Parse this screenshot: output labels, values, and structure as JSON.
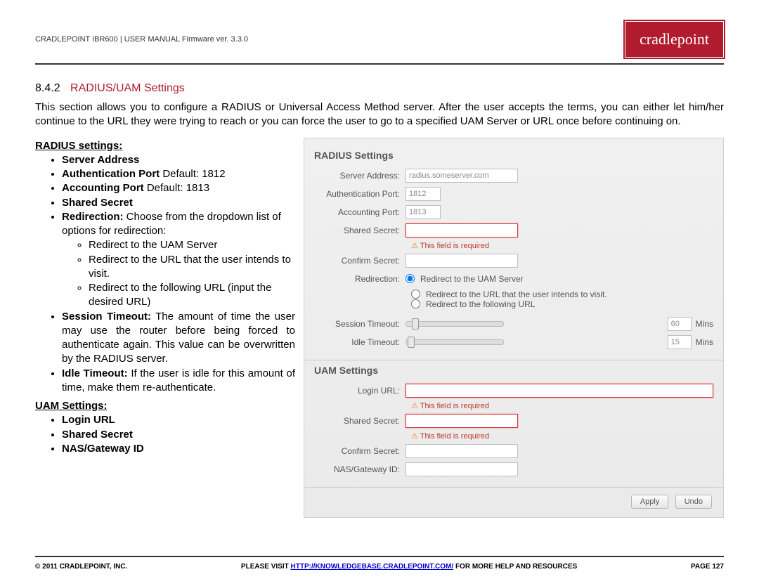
{
  "header": {
    "doc_title": "CRADLEPOINT IBR600 | USER MANUAL Firmware ver. 3.3.0",
    "brand": "cradlepoint"
  },
  "section": {
    "number": "8.4.2",
    "title": "RADIUS/UAM Settings",
    "intro": "This section allows you to configure a RADIUS or Universal Access Method server. After the user accepts the terms, you can either let him/her continue to the URL they were trying to reach or you can force the user to go to a specified UAM Server or URL once before continuing on."
  },
  "left": {
    "radius_heading": "RADIUS settings",
    "bullets": {
      "server": "Server Address",
      "auth_port_label": "Authentication Port",
      "auth_port_default": " Default: 1812",
      "acct_port_label": "Accounting Port",
      "acct_port_default": " Default: 1813",
      "shared_secret": "Shared Secret",
      "redirection_label": "Redirection:",
      "redirection_desc": " Choose from the dropdown list of options for redirection:",
      "redir_opt1": "Redirect to the UAM Server",
      "redir_opt2": "Redirect to the URL that the user intends to visit.",
      "redir_opt3": "Redirect to the following URL (input the desired URL)",
      "session_label": "Session Timeout:",
      "session_desc": " The amount of time the user may use the router before being forced to authenticate again. This value can be overwritten by the RADIUS server.",
      "idle_label": "Idle Timeout:",
      "idle_desc": " If the user is idle for this amount of time, make them re-authenticate."
    },
    "uam_heading": "UAM Settings",
    "uam_bullets": {
      "login": "Login URL",
      "secret": "Shared Secret",
      "nas": "NAS/Gateway ID"
    }
  },
  "panel": {
    "radius": {
      "title": "RADIUS Settings",
      "server_label": "Server Address:",
      "server_value": "radius.someserver.com",
      "auth_label": "Authentication Port:",
      "auth_value": "1812",
      "acct_label": "Accounting Port:",
      "acct_value": "1813",
      "secret_label": "Shared Secret:",
      "secret_err": "This field is required",
      "confirm_label": "Confirm Secret:",
      "redir_label": "Redirection:",
      "redir_opt1": "Redirect to the UAM Server",
      "redir_opt2": "Redirect to the URL that the user intends to visit.",
      "redir_opt3": "Redirect to the following URL",
      "session_label": "Session Timeout:",
      "session_value": "60",
      "idle_label": "Idle Timeout:",
      "idle_value": "15",
      "mins": "Mins"
    },
    "uam": {
      "title": "UAM Settings",
      "login_label": "Login URL:",
      "login_err": "This field is required",
      "secret_label": "Shared Secret:",
      "secret_err": "This field is required",
      "confirm_label": "Confirm Secret:",
      "nas_label": "NAS/Gateway ID:"
    },
    "buttons": {
      "apply": "Apply",
      "undo": "Undo"
    }
  },
  "footer": {
    "copyright": "© 2011 CRADLEPOINT, INC.",
    "visit_pre": "PLEASE VISIT ",
    "visit_link": "HTTP://KNOWLEDGEBASE.CRADLEPOINT.COM/",
    "visit_post": " FOR MORE HELP AND RESOURCES",
    "page": "PAGE 127"
  }
}
